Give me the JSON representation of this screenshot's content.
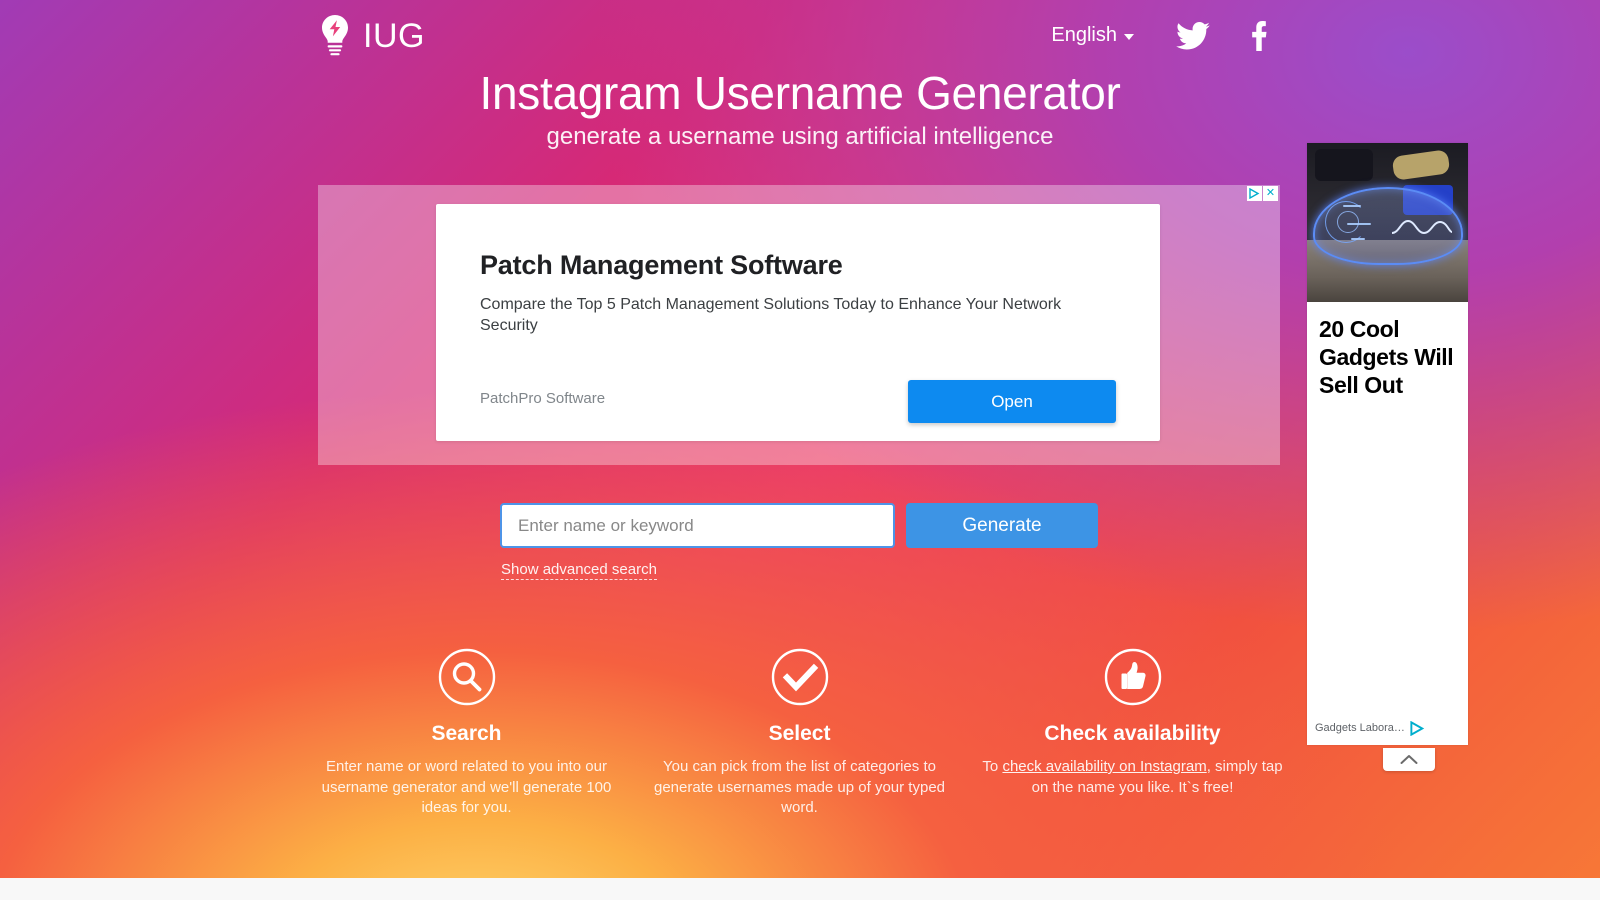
{
  "header": {
    "logo_text": "IUG",
    "logo_icon": "lightbulb-bolt-icon",
    "language": "English",
    "twitter_icon": "twitter-icon",
    "facebook_icon": "facebook-icon"
  },
  "hero": {
    "title": "Instagram Username Generator",
    "subtitle": "generate a username using artificial intelligence"
  },
  "banner_ad": {
    "headline": "Patch Management Software",
    "body": "Compare the Top 5 Patch Management Solutions Today to Enhance Your Network Security",
    "advertiser": "PatchPro Software",
    "cta_label": "Open",
    "adchoices_icon": "adchoices-icon",
    "close_icon": "close-icon",
    "close_label": "✕"
  },
  "search": {
    "placeholder": "Enter name or keyword",
    "value": "",
    "generate_label": "Generate",
    "advanced_label": "Show advanced search"
  },
  "features": [
    {
      "icon": "search-icon",
      "title": "Search",
      "description": "Enter name or word related to you into our username generator and we'll generate 100 ideas for you."
    },
    {
      "icon": "check-icon",
      "title": "Select",
      "description": "You can pick from the list of categories to generate usernames made up of your typed word."
    },
    {
      "icon": "thumbs-up-icon",
      "title": "Check availability",
      "description_before": "To ",
      "link_text": "check availability on Instagram",
      "description_after": ", simply tap on the name you like. It`s free!"
    }
  ],
  "side_ad": {
    "image_alt": "glowing-blue-ar-glasses",
    "headline": "20 Cool Gadgets Will Sell Out",
    "advertiser": "Gadgets Labora…",
    "adchoices_icon": "adchoices-icon",
    "collapse_icon": "chevron-up-icon"
  },
  "colors": {
    "accent_blue": "#3d94e5",
    "ad_button_blue": "#0d8af0",
    "gradient_start": "#a13bb5",
    "gradient_mid": "#d62976",
    "gradient_end": "#ffd86f"
  }
}
